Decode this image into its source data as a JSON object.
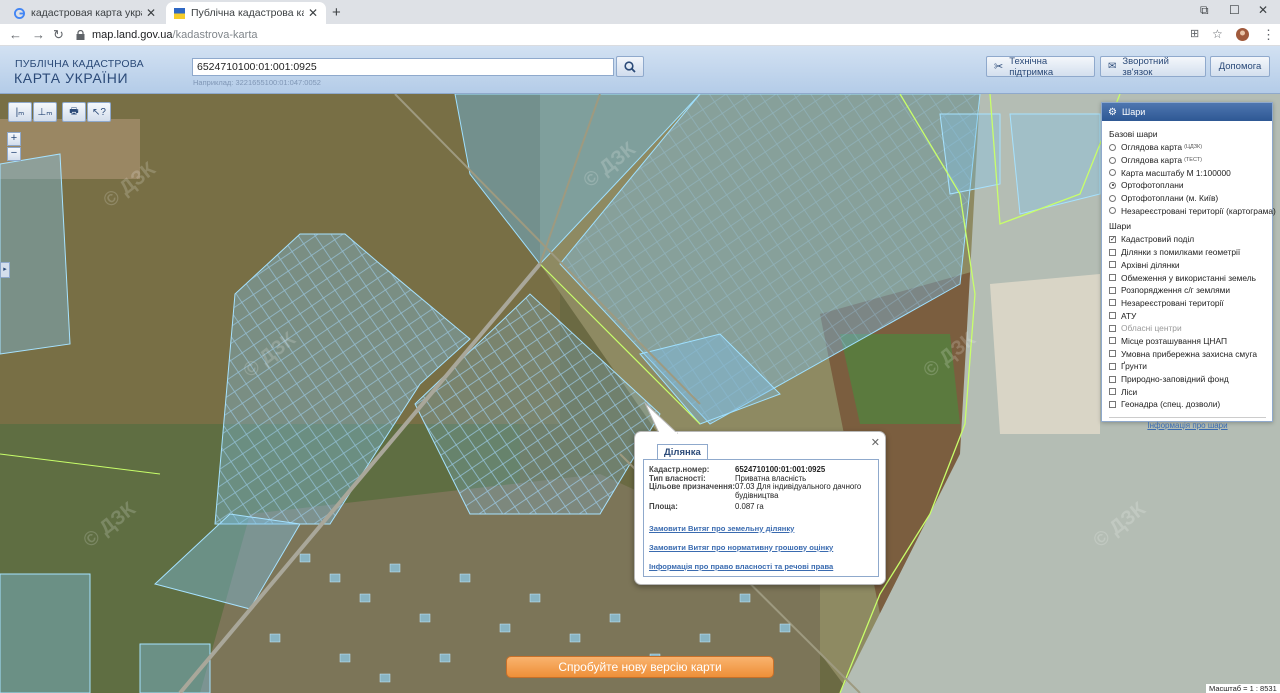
{
  "browser": {
    "tabs": [
      {
        "title": "кадастровая карта украины\\ - По"
      },
      {
        "title": "Публічна кадастрова карта Укр"
      }
    ],
    "url_host": "map.land.gov.ua",
    "url_path": "/kadastrova-karta"
  },
  "header": {
    "brand_line1": "ПУБЛІЧНА КАДАСТРОВА",
    "brand_line2": "КАРТА УКРАЇНИ",
    "search_value": "6524710100:01:001:0925",
    "search_hint": "Наприклад: 3221655100:01:047:0052",
    "buttons": {
      "support": "Технічна підтримка",
      "feedback": "Зворотний зв'язок",
      "help": "Допомога"
    }
  },
  "layers": {
    "title": "Шари",
    "base_title": "Базові шари",
    "base": [
      {
        "label": "Оглядова карта",
        "sup": "(ЦДЗК)",
        "checked": false
      },
      {
        "label": "Оглядова карта",
        "sup": "(ТЕСТ)",
        "checked": false
      },
      {
        "label": "Карта масштабу М 1:100000",
        "sup": "",
        "checked": false
      },
      {
        "label": "Ортофотоплани",
        "sup": "",
        "checked": true
      },
      {
        "label": "Ортофотоплани (м. Київ)",
        "sup": "",
        "checked": false
      },
      {
        "label": "Незареєстровані території (картограма)",
        "sup": "",
        "checked": false
      }
    ],
    "layers_title": "Шари",
    "items": [
      {
        "label": "Кадастровий поділ",
        "checked": true
      },
      {
        "label": "Ділянки з помилками геометрії",
        "checked": false
      },
      {
        "label": "Архівні ділянки",
        "checked": false
      },
      {
        "label": "Обмеження у використанні земель",
        "checked": false
      },
      {
        "label": "Розпорядження с/г землями",
        "checked": false
      },
      {
        "label": "Незареєстровані території",
        "checked": false
      },
      {
        "label": "АТУ",
        "checked": false
      },
      {
        "label": "Обласні центри",
        "checked": false,
        "disabled": true
      },
      {
        "label": "Місце розташування ЦНАП",
        "checked": false
      },
      {
        "label": "Умовна прибережна захисна смуга",
        "checked": false
      },
      {
        "label": "Ґрунти",
        "checked": false
      },
      {
        "label": "Природно-заповідний фонд",
        "checked": false
      },
      {
        "label": "Ліси",
        "checked": false
      },
      {
        "label": "Геонадра (спец. дозволи)",
        "checked": false
      }
    ],
    "info_link": "Інформація про шари"
  },
  "popup": {
    "tab": "Ділянка",
    "cadastral_label": "Кадастр.номер:",
    "cadastral_value": "6524710100:01:001:0925",
    "ownership_label": "Тип власності:",
    "ownership_value": "Приватна власність",
    "purpose_label": "Цільове призначення:",
    "purpose_value": "07.03 Для індивідуального дачного будівництва",
    "area_label": "Площа:",
    "area_value": "0.087 га",
    "links": [
      "Замовити Витяг про земельну ділянку",
      "Замовити Витяг про нормативну грошову оцінку",
      "Інформація про право власності та речові права"
    ]
  },
  "map": {
    "try_new": "Спробуйте нову версію карти",
    "scale": "Масштаб = 1 : 8531",
    "watermark": "© ДЗК"
  }
}
